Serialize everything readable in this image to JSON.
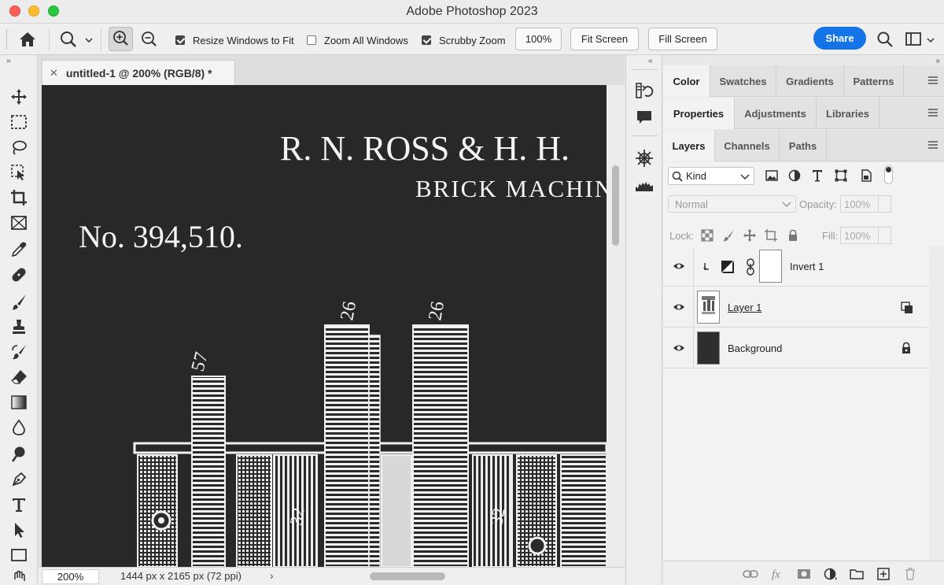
{
  "window": {
    "title": "Adobe Photoshop 2023"
  },
  "options": {
    "resize_windows": {
      "label": "Resize Windows to Fit",
      "checked": true
    },
    "zoom_all": {
      "label": "Zoom All Windows",
      "checked": false
    },
    "scrubby_zoom": {
      "label": "Scrubby Zoom",
      "checked": true
    },
    "zoom_percent": "100%",
    "fit_screen": "Fit Screen",
    "fill_screen": "Fill Screen",
    "share": "Share"
  },
  "tools": [
    "move-tool",
    "marquee-tool",
    "lasso-tool",
    "object-select-tool",
    "crop-tool",
    "frame-tool",
    "eyedropper-tool",
    "healing-tool",
    "brush-tool",
    "stamp-tool",
    "history-brush-tool",
    "eraser-tool",
    "gradient-tool",
    "blur-tool",
    "dodge-tool",
    "pen-tool",
    "type-tool",
    "path-select-tool",
    "rectangle-tool",
    "hand-tool"
  ],
  "document": {
    "tab_title": "untitled-1 @ 200% (RGB/8) *",
    "zoom": "200%",
    "info": "1444 px x 2165 px (72 ppi)",
    "canvas_text": {
      "heading": "R. N. ROSS & H. H.",
      "subheading": "BRICK MACHIN",
      "number": "No. 394,510.",
      "label_57": "57",
      "label_26a": "26",
      "label_26b": "26",
      "label_32a": "32",
      "label_32b": "32"
    }
  },
  "panels": {
    "color_tabs": [
      "Color",
      "Swatches",
      "Gradients",
      "Patterns"
    ],
    "props_tabs": [
      "Properties",
      "Adjustments",
      "Libraries"
    ],
    "layer_tabs": [
      "Layers",
      "Channels",
      "Paths"
    ],
    "filter_kind": "Kind",
    "blend_mode": "Normal",
    "opacity_label": "Opacity:",
    "opacity_value": "100%",
    "lock_label": "Lock:",
    "fill_label": "Fill:",
    "fill_value": "100%",
    "layers": [
      {
        "name": "Invert 1",
        "visible": true
      },
      {
        "name": "Layer 1",
        "visible": true
      },
      {
        "name": "Background",
        "visible": true,
        "locked": true
      }
    ]
  }
}
